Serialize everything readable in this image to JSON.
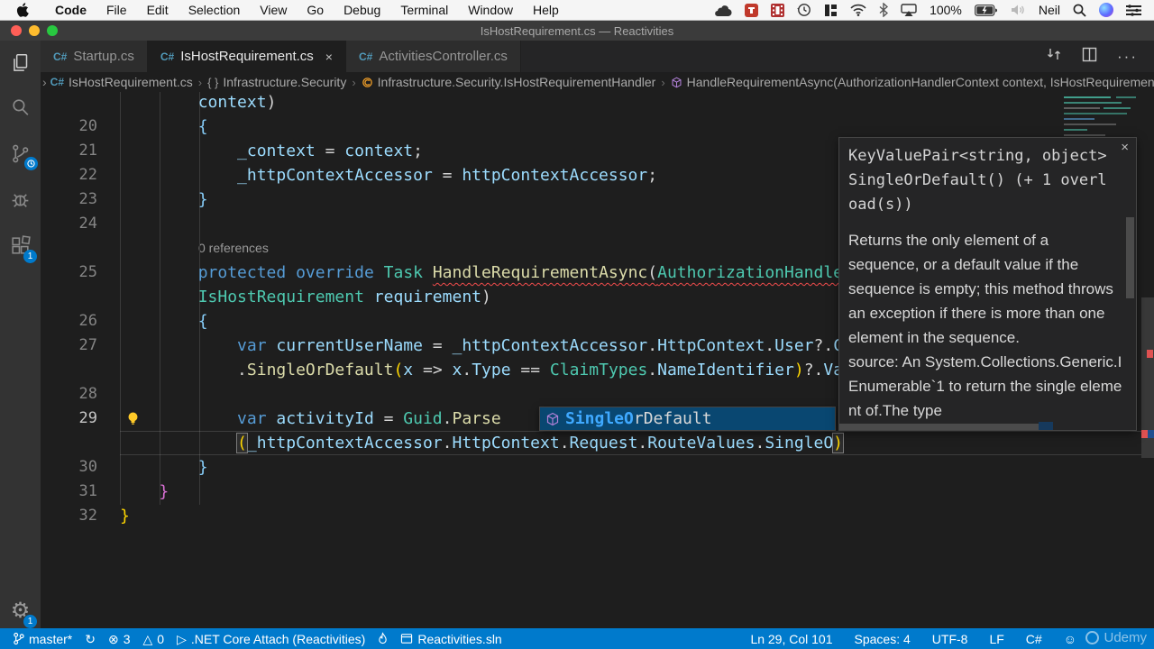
{
  "menubar": {
    "items": [
      "Code",
      "File",
      "Edit",
      "Selection",
      "View",
      "Go",
      "Debug",
      "Terminal",
      "Window",
      "Help"
    ],
    "battery": "100%",
    "user": "Neil"
  },
  "titlebar": {
    "title": "IsHostRequirement.cs — Reactivities"
  },
  "tabs": [
    {
      "label": "Startup.cs",
      "active": false
    },
    {
      "label": "IsHostRequirement.cs",
      "active": true
    },
    {
      "label": "ActivitiesController.cs",
      "active": false
    }
  ],
  "breadcrumbs": [
    {
      "icon": "csharp-file-icon",
      "label": "IsHostRequirement.cs"
    },
    {
      "icon": "namespace-icon",
      "label": "Infrastructure.Security"
    },
    {
      "icon": "class-icon",
      "label": "Infrastructure.Security.IsHostRequirementHandler"
    },
    {
      "icon": "method-icon",
      "label": "HandleRequirementAsync(AuthorizationHandlerContext context, IsHostRequirement requiremen"
    }
  ],
  "editor": {
    "codelens": "0 references",
    "rows": [
      {
        "num": "",
        "segs": [
          [
            "        ",
            "pu"
          ],
          [
            "context",
            "va"
          ],
          [
            ")",
            "pu"
          ]
        ]
      },
      {
        "num": "20",
        "segs": [
          [
            "        ",
            "pu"
          ],
          [
            "{",
            "bb"
          ]
        ]
      },
      {
        "num": "21",
        "segs": [
          [
            "            ",
            "pu"
          ],
          [
            "_context",
            "va"
          ],
          [
            " = ",
            "pu"
          ],
          [
            "context",
            "va"
          ],
          [
            ";",
            "pu"
          ]
        ]
      },
      {
        "num": "22",
        "segs": [
          [
            "            ",
            "pu"
          ],
          [
            "_httpContextAccessor",
            "va"
          ],
          [
            " = ",
            "pu"
          ],
          [
            "httpContextAccessor",
            "va"
          ],
          [
            ";",
            "pu"
          ]
        ]
      },
      {
        "num": "23",
        "segs": [
          [
            "        ",
            "pu"
          ],
          [
            "}",
            "bb"
          ]
        ]
      },
      {
        "num": "24",
        "segs": []
      },
      {
        "lens": true
      },
      {
        "num": "25",
        "segs": [
          [
            "        ",
            "pu"
          ],
          [
            "protected",
            "kw"
          ],
          [
            " ",
            "pu"
          ],
          [
            "override",
            "kw"
          ],
          [
            " ",
            "pu"
          ],
          [
            "Task",
            "ty"
          ],
          [
            " ",
            "pu"
          ],
          [
            "HandleRequirementAsync",
            "fn sq"
          ],
          [
            "(",
            "pu sq"
          ],
          [
            "AuthorizationHandle",
            "ty sq"
          ]
        ]
      },
      {
        "num": "",
        "segs": [
          [
            "        ",
            "pu"
          ],
          [
            "IsHostRequirement",
            "ty"
          ],
          [
            " ",
            "pu"
          ],
          [
            "requirement",
            "va"
          ],
          [
            ")",
            "pu"
          ]
        ]
      },
      {
        "num": "26",
        "segs": [
          [
            "        ",
            "pu"
          ],
          [
            "{",
            "bb"
          ]
        ]
      },
      {
        "num": "27",
        "segs": [
          [
            "            ",
            "pu"
          ],
          [
            "var",
            "kw"
          ],
          [
            " ",
            "pu"
          ],
          [
            "currentUserName",
            "va"
          ],
          [
            " = ",
            "pu"
          ],
          [
            "_httpContextAccessor",
            "va"
          ],
          [
            ".",
            "pu"
          ],
          [
            "HttpContext",
            "va"
          ],
          [
            ".",
            "pu"
          ],
          [
            "User",
            "va"
          ],
          [
            "?.",
            "pu"
          ],
          [
            "C",
            "va"
          ]
        ]
      },
      {
        "num": "",
        "segs": [
          [
            "            ",
            "pu"
          ],
          [
            ".",
            "pu"
          ],
          [
            "SingleOrDefault",
            "fn"
          ],
          [
            "(",
            "by"
          ],
          [
            "x",
            "va"
          ],
          [
            " ",
            "pu"
          ],
          [
            "=>",
            "pu"
          ],
          [
            " ",
            "pu"
          ],
          [
            "x",
            "va"
          ],
          [
            ".",
            "pu"
          ],
          [
            "Type",
            "va"
          ],
          [
            " == ",
            "pu"
          ],
          [
            "ClaimTypes",
            "ty"
          ],
          [
            ".",
            "pu"
          ],
          [
            "NameIdentifier",
            "va"
          ],
          [
            ")",
            "by"
          ],
          [
            "?.",
            "pu"
          ],
          [
            "Va",
            "va"
          ]
        ]
      },
      {
        "num": "28",
        "segs": []
      },
      {
        "num": "29",
        "bulb": true,
        "segs": [
          [
            "            ",
            "pu"
          ],
          [
            "var",
            "kw"
          ],
          [
            " ",
            "pu"
          ],
          [
            "activityId",
            "va"
          ],
          [
            " = ",
            "pu"
          ],
          [
            "Guid",
            "ty"
          ],
          [
            ".",
            "pu"
          ],
          [
            "Parse",
            "fn"
          ]
        ]
      },
      {
        "num": "",
        "cur": true,
        "segs": [
          [
            "            ",
            "pu"
          ],
          [
            "(",
            "bm"
          ],
          [
            "_httpContextAccessor",
            "va"
          ],
          [
            ".",
            "pu"
          ],
          [
            "HttpContext",
            "va"
          ],
          [
            ".",
            "pu"
          ],
          [
            "Request",
            "va"
          ],
          [
            ".",
            "pu"
          ],
          [
            "RouteValues",
            "va"
          ],
          [
            ".",
            "pu"
          ],
          [
            "SingleO",
            "va"
          ],
          [
            ")",
            "bm"
          ]
        ]
      },
      {
        "num": "30",
        "segs": [
          [
            "        ",
            "pu"
          ],
          [
            "}",
            "bb"
          ]
        ]
      },
      {
        "num": "31",
        "segs": [
          [
            "    ",
            "pu"
          ],
          [
            "}",
            "bp"
          ]
        ]
      },
      {
        "num": "32",
        "segs": [
          [
            "}",
            "by"
          ]
        ]
      }
    ]
  },
  "suggest": {
    "match": "SingleO",
    "rest": "rDefault"
  },
  "hover": {
    "signature": "KeyValuePair<string, object> SingleOrDefault() (+ 1 overload(s))",
    "description": "Returns the only element of a sequence, or a default value if the sequence is empty; this method throws an exception if there is more than one element in the sequence.",
    "source": "source: An System.Collections.Generic.IEnumerable`1 to return the single element of.The type",
    "close": "×"
  },
  "statusbar": {
    "left": [
      {
        "icon": "git-branch-icon",
        "label": "master*"
      },
      {
        "icon": "sync-icon",
        "label": ""
      },
      {
        "icon": "errors-icon",
        "label": "3"
      },
      {
        "icon": "warnings-icon",
        "label": "0"
      },
      {
        "icon": "play-icon",
        "label": ".NET Core Attach (Reactivities)"
      },
      {
        "icon": "flame-icon",
        "label": ""
      },
      {
        "icon": "solution-icon",
        "label": "Reactivities.sln"
      }
    ],
    "right": [
      "Ln 29, Col 101",
      "Spaces: 4",
      "UTF-8",
      "LF",
      "C#"
    ],
    "feedback_icon": "☺"
  },
  "watermark": "Udemy",
  "colors": {
    "accent": "#007acc",
    "error": "#f14c4c",
    "selection": "#094771",
    "csharp_icon": "#519aba",
    "bracket_gold": "#ffd700",
    "bracket_pink": "#da70d6",
    "bracket_blue": "#87cefa"
  }
}
